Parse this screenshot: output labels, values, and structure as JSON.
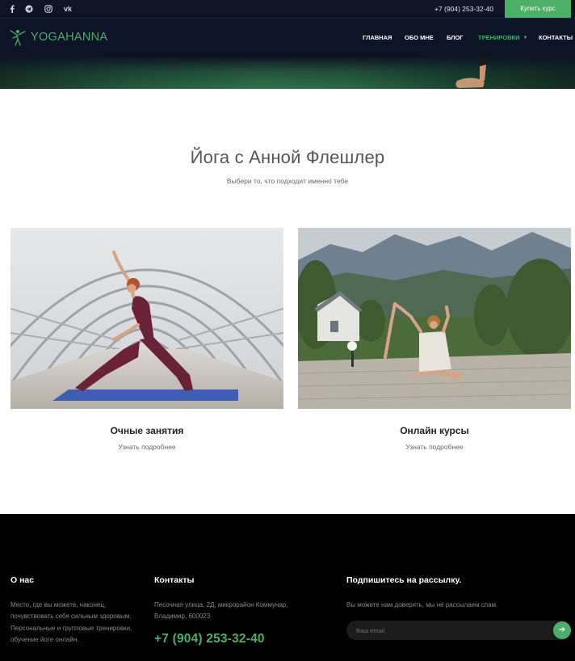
{
  "topbar": {
    "social": [
      {
        "name": "facebook-icon"
      },
      {
        "name": "telegram-icon"
      },
      {
        "name": "instagram-icon"
      },
      {
        "name": "vk-icon",
        "text": "vk"
      }
    ],
    "phone": "+7 (904) 253-32-40",
    "buy_button": "Купить курс"
  },
  "header": {
    "logo_text": "YOGAHANNA",
    "nav": [
      {
        "label": "ГЛАВНАЯ",
        "active": false
      },
      {
        "label": "ОБО МНЕ",
        "active": false
      },
      {
        "label": "БЛОГ",
        "active": false
      },
      {
        "label": "ТРЕНИРОВКИ",
        "active": true,
        "dropdown": true
      },
      {
        "label": "КОНТАКТЫ",
        "active": false
      }
    ]
  },
  "main": {
    "title": "Йога с Анной Флешлер",
    "subtitle": "Выбери то, что подходит именно тебе",
    "cards": [
      {
        "title": "Очные занятия",
        "link": "Узнать подробнее"
      },
      {
        "title": "Онлайн курсы",
        "link": "Узнать подробнее"
      }
    ]
  },
  "footer": {
    "about": {
      "heading": "О нас",
      "text": "Место, где вы можете, наконец, почувствовать себя сильным здоровым. Персональные и групповые тренировки, обучение йоге онлайн."
    },
    "contacts": {
      "heading": "Контакты",
      "address": "Песочная улица, 2Д, микрорайон Коммунар, Владимир, 600023",
      "phone": "+7 (904) 253-32-40"
    },
    "newsletter": {
      "heading": "Подпишитесь на рассылку.",
      "text": "Вы можете нам доверять, мы не рассылаем спам.",
      "placeholder": "Ваш email"
    }
  },
  "colors": {
    "accent": "#4caf67",
    "navbar": "#0d1426",
    "footer": "#000000"
  }
}
